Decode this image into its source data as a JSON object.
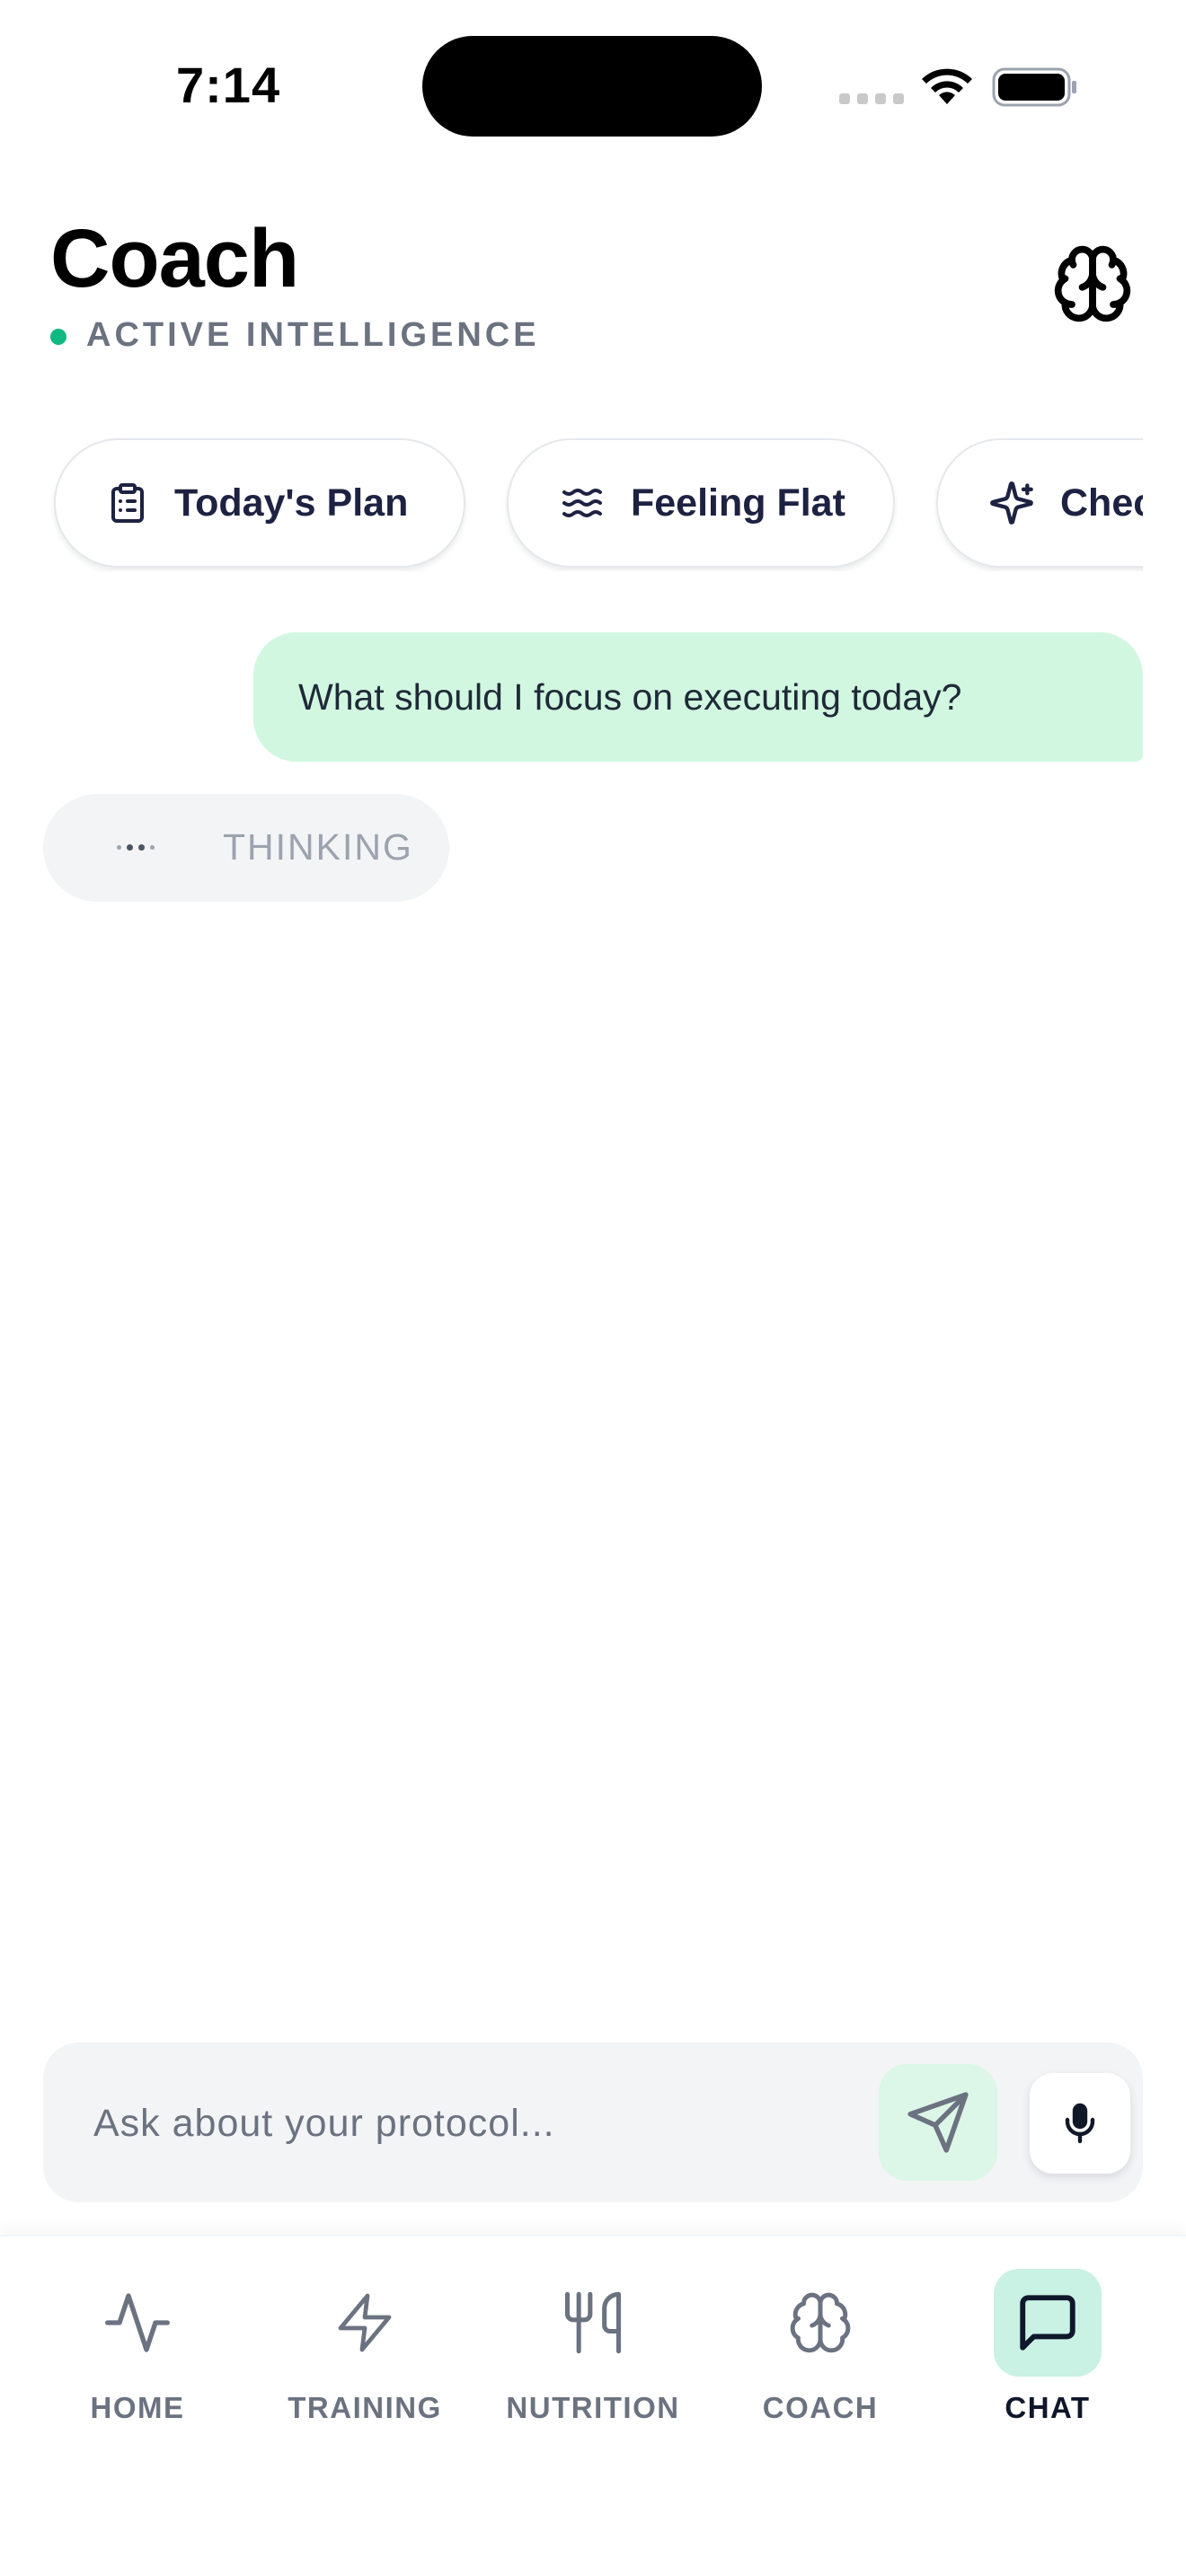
{
  "status_bar": {
    "time": "7:14"
  },
  "header": {
    "title": "Coach",
    "status_label": "ACTIVE INTELLIGENCE",
    "status_color": "#10b981",
    "header_icon": "brain-icon"
  },
  "chips": [
    {
      "label": "Today's Plan",
      "icon": "clipboard-icon"
    },
    {
      "label": "Feeling Flat",
      "icon": "waves-icon"
    },
    {
      "label": "Chec",
      "icon": "sparkles-icon"
    }
  ],
  "conversation": {
    "user_message": "What should I focus on executing today?",
    "assistant_status": "THINKING"
  },
  "composer": {
    "placeholder": "Ask about your protocol...",
    "value": "",
    "send_icon": "send-icon",
    "mic_icon": "microphone-icon"
  },
  "nav": {
    "items": [
      {
        "label": "HOME",
        "icon": "activity-icon",
        "active": false
      },
      {
        "label": "TRAINING",
        "icon": "lightning-icon",
        "active": false
      },
      {
        "label": "NUTRITION",
        "icon": "utensils-icon",
        "active": false
      },
      {
        "label": "COACH",
        "icon": "brain-icon",
        "active": false
      },
      {
        "label": "CHAT",
        "icon": "chat-bubble-icon",
        "active": true
      }
    ]
  },
  "colors": {
    "accent": "#10b981",
    "user_bubble": "#d1f7e1",
    "active_nav": "#c9f1e4",
    "chip_text": "#1e2242"
  }
}
